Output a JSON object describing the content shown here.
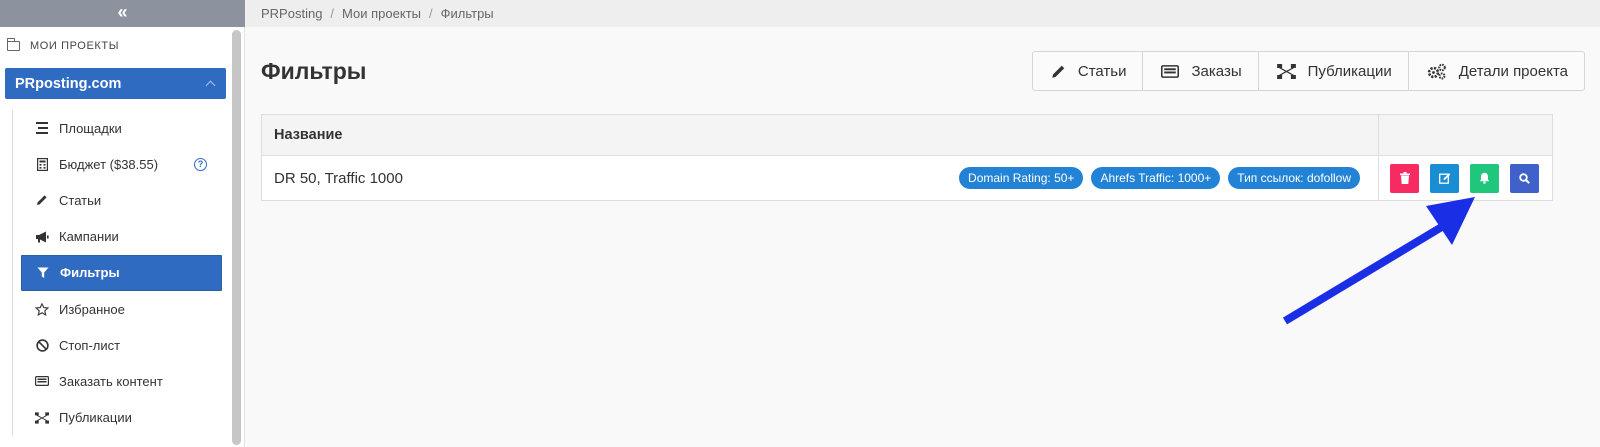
{
  "sidebar": {
    "collapse_label": "«",
    "section_label": "МОИ ПРОЕКТЫ",
    "project_name": "PRposting.com",
    "items": [
      {
        "label": "Площадки",
        "icon": "list-icon"
      },
      {
        "label": "Бюджет ($38.55)",
        "icon": "calculator-icon",
        "help": "?"
      },
      {
        "label": "Статьи",
        "icon": "pencil-icon"
      },
      {
        "label": "Кампании",
        "icon": "megaphone-icon"
      },
      {
        "label": "Фильтры",
        "icon": "filter-icon",
        "active": true
      },
      {
        "label": "Избранное",
        "icon": "star-icon"
      },
      {
        "label": "Стоп-лист",
        "icon": "ban-icon"
      },
      {
        "label": "Заказать контент",
        "icon": "keyboard-icon"
      },
      {
        "label": "Публикации",
        "icon": "sitemap-icon"
      }
    ]
  },
  "breadcrumb": [
    "PRPosting",
    "Мои проекты",
    "Фильтры"
  ],
  "page_title": "Фильтры",
  "header_buttons": [
    {
      "label": "Статьи",
      "icon": "pencil-icon"
    },
    {
      "label": "Заказы",
      "icon": "keyboard-icon"
    },
    {
      "label": "Публикации",
      "icon": "sitemap-icon"
    },
    {
      "label": "Детали проекта",
      "icon": "gears-icon"
    }
  ],
  "table": {
    "column_name": "Название",
    "rows": [
      {
        "name": "DR 50, Traffic 1000",
        "tags": [
          "Domain Rating: 50+",
          "Ahrefs Traffic: 1000+",
          "Тип ссылок: dofollow"
        ],
        "actions": [
          "trash-icon",
          "edit-icon",
          "bell-icon",
          "search-icon"
        ]
      }
    ]
  },
  "colors": {
    "primary": "#2f6bc1",
    "tag": "#2283d6",
    "delete": "#f52b62",
    "edit": "#1a8ed4",
    "bell": "#21c67d",
    "search": "#3f61c9",
    "annotation_arrow": "#1a2ee6"
  }
}
